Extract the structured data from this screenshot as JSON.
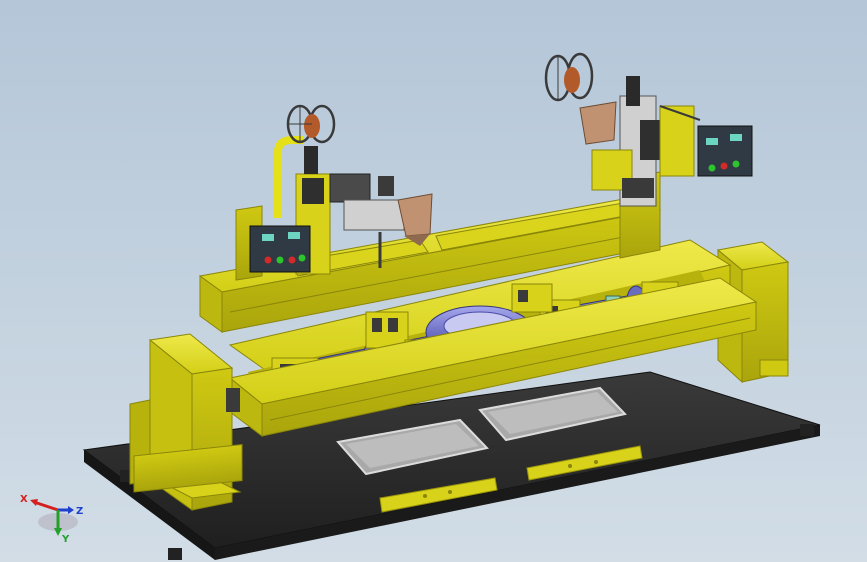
{
  "viewport": {
    "background_top": "#b4c6d8",
    "background_bottom": "#d2dde6"
  },
  "model": {
    "machine_color": "#e0dc1a",
    "machine_dark": "#a8a20a",
    "base_color": "#2b2b2b",
    "workpiece_color": "#7d7fd0",
    "wire_spool_color": "#b35a2a",
    "hopper_color": "#c19272",
    "panel_color": "#2f3a44"
  },
  "triad": {
    "x_label": "X",
    "y_label": "Y",
    "z_label": "Z",
    "x_color": "#d42020",
    "y_color": "#22a02a",
    "z_color": "#2040d0"
  }
}
